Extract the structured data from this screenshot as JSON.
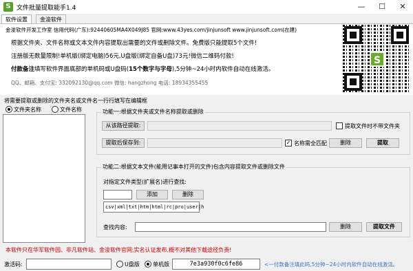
{
  "window": {
    "title": "文件批量提取能手1.4",
    "app_icon": "S"
  },
  "tabs": [
    {
      "label": "软件设置"
    },
    {
      "label": "金浚软件"
    }
  ],
  "info": {
    "line1": "金浚软件开发工作室  信用代码(广东):92440605MA4X049J85  官网:www.43yes.com/jinjunsoft  www.jinjunsoft.com(在建)",
    "line2": "根据文件夹、文件名称或文本文件内容提取出需要的文件或删除文件。免费版只能提取5个文件!",
    "line3": "注册版无数量限制!单机版(绑定电脑)56元,U盘版(绑定自备U盘)73元!微信二维码付款!",
    "line4_bold": "付款备注",
    "line4_rest_a": "填写软件界面底部的单机码或U盘码(",
    "line4_bold2": "15个数字与字母",
    "line4_rest_b": "),5分钟~24小时内软件自动在线激活。",
    "line5": "QQ、邮箱、支付宝: 332092130@qq.com   微信: hangzhong   电话: 18934355455",
    "qr_logo": "S"
  },
  "instruction": "将需要提取或删除的文件夹名或文件名一行行填写在编辑框",
  "mode": {
    "folder_label": "文件夹名称",
    "file_label": "文件名称",
    "selected": "folder"
  },
  "func1": {
    "title": "功能一:根据文件夹或文件名称提取或删除",
    "from_path_button": "从该路径提取:",
    "from_path_value": "",
    "no_folder_check_label": "提取文件时不带文件夹",
    "no_folder_checked": false,
    "save_button": "提取后保存到:",
    "save_value": "",
    "exact_match_label": "名称需全匹配",
    "exact_match_checked": true,
    "delete_button": "删除",
    "extract_button": "提取"
  },
  "func2": {
    "title": "功能二:根据文本文件(能用记事本打开的文件)包含内容提取文件或删除文件",
    "ext_label": "对指定文件类型(扩展名)进行查找:",
    "ext_input": "",
    "add_button": "添加",
    "delete_ext_button": "删除",
    "ext_list": "csv|xml|txt|htm|html|rc|pro|user|h",
    "search_label": "查找内容:",
    "search_value": "",
    "delete_button": "删除",
    "extract_button": "提取文件"
  },
  "notice": "本软件只在华军软件园、非凡软件站、金浚软件官网,实名认证发布,概不对其他下载途径负责!",
  "status": {
    "activation_label": "激活码:",
    "activation_value": "",
    "usb_label": "U盘版",
    "standalone_label": "单机版",
    "selected": "standalone",
    "machine_code": "7e3a930f0c6fe86",
    "hint": "<一付款备注填此码,5分钟~24小时内软件自动在线激活。"
  },
  "colors": {
    "notice_red": "#d00000",
    "hint_blue": "#3a6fc8",
    "qr_green": "#6aaa2e"
  }
}
